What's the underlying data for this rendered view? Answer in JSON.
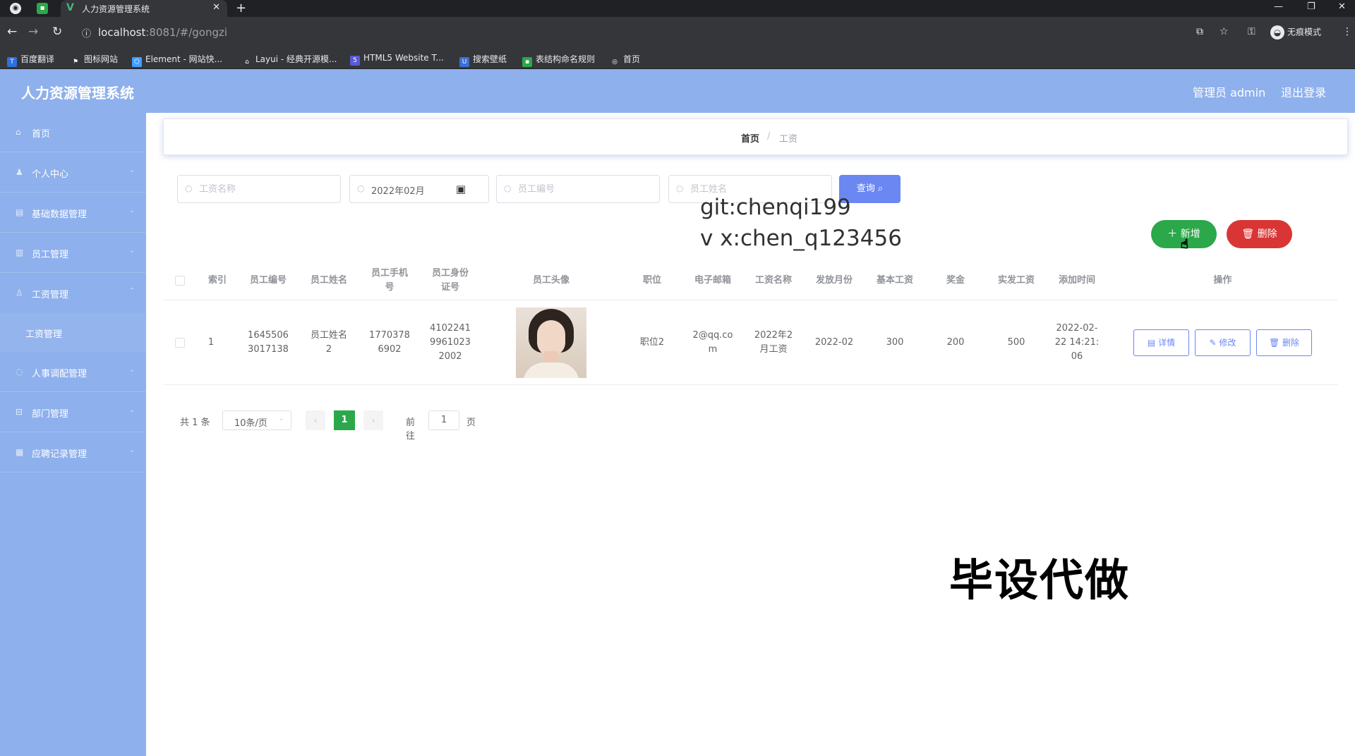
{
  "browser": {
    "tab_title": "人力资源管理系统",
    "url_host": "localhost",
    "url_rest": ":8081/#/gongzi",
    "incognito_label": "无痕模式",
    "bookmarks": [
      "百度翻译",
      "图标网站",
      "Element - 网站快...",
      "Layui - 经典开源模...",
      "HTML5 Website T...",
      "搜索壁纸",
      "表结构命名规则",
      "首页"
    ]
  },
  "header": {
    "app_title": "人力资源管理系统",
    "admin_label": "管理员 admin",
    "logout_label": "退出登录"
  },
  "sidebar": {
    "items": [
      {
        "label": "首页",
        "icon": "home-icon"
      },
      {
        "label": "个人中心",
        "icon": "user-icon"
      },
      {
        "label": "基础数据管理",
        "icon": "data-icon"
      },
      {
        "label": "员工管理",
        "icon": "staff-icon"
      },
      {
        "label": "工资管理",
        "icon": "salary-icon"
      },
      {
        "label": "人事调配管理",
        "icon": "transfer-icon"
      },
      {
        "label": "部门管理",
        "icon": "dept-icon"
      },
      {
        "label": "应聘记录管理",
        "icon": "record-icon"
      }
    ],
    "sub_item": "工资管理"
  },
  "breadcrumb": {
    "home": "首页",
    "separator": "/",
    "current": "工资"
  },
  "search": {
    "salary_name_placeholder": "工资名称",
    "month_value": "2022年02月",
    "emp_no_placeholder": "员工编号",
    "emp_name_placeholder": "员工姓名",
    "query_label": "查询"
  },
  "watermark": {
    "line1": "git:chenqi199",
    "line2": "v x:chen_q123456",
    "corner": "毕设代做"
  },
  "actions": {
    "add_label": "新增",
    "delete_label": "删除"
  },
  "table": {
    "headers": [
      "索引",
      "员工编号",
      "员工姓名",
      "员工手机号",
      "员工身份证号",
      "员工头像",
      "职位",
      "电子邮箱",
      "工资名称",
      "发放月份",
      "基本工资",
      "奖金",
      "实发工资",
      "添加时间",
      "操作"
    ],
    "rows": [
      {
        "index": "1",
        "emp_no": "16455063017138",
        "emp_name": "员工姓名2",
        "phone": "17703786902",
        "id_card": "410224199610232002",
        "position": "职位2",
        "email": "2@qq.com",
        "salary_name": "2022年2月工资",
        "month": "2022-02",
        "base": "300",
        "bonus": "200",
        "actual": "500",
        "added": "2022-02-22 14:21:06",
        "detail_label": "详情",
        "edit_label": "修改",
        "delete_label": "删除"
      }
    ]
  },
  "pagination": {
    "total": "共 1 条",
    "page_size": "10条/页",
    "current": "1",
    "goto": "前往",
    "goto_value": "1",
    "page_suffix": "页"
  },
  "colors": {
    "theme": "#8eb0ec",
    "primary": "#6b87f2",
    "success": "#2ba84a",
    "danger": "#d93535"
  }
}
